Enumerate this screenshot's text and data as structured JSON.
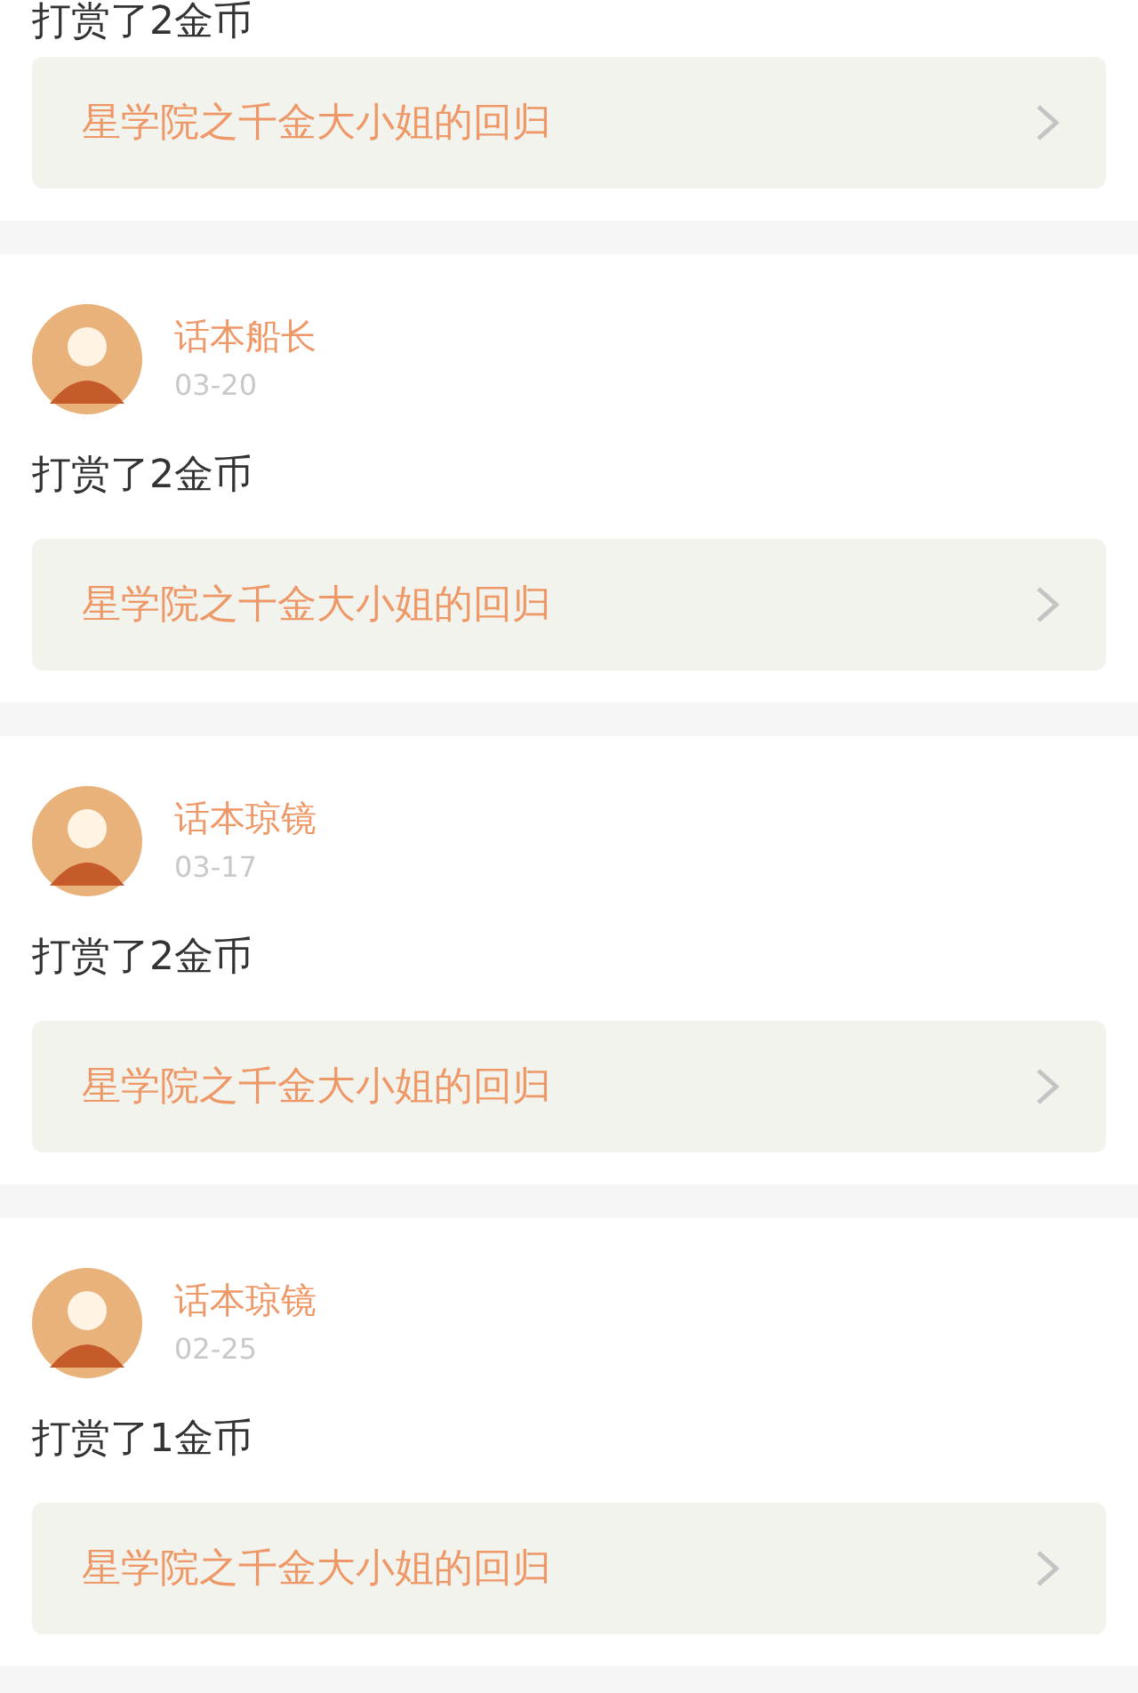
{
  "records": [
    {
      "kind": "partial",
      "text": "打赏了2金币",
      "book": "星学院之千金大小姐的回归"
    },
    {
      "kind": "full",
      "user": "话本船长",
      "date": "03-20",
      "text": "打赏了2金币",
      "book": "星学院之千金大小姐的回归"
    },
    {
      "kind": "full",
      "user": "话本琼镜",
      "date": "03-17",
      "text": "打赏了2金币",
      "book": "星学院之千金大小姐的回归"
    },
    {
      "kind": "full",
      "user": "话本琼镜",
      "date": "02-25",
      "text": "打赏了1金币",
      "book": "星学院之千金大小姐的回归"
    }
  ]
}
